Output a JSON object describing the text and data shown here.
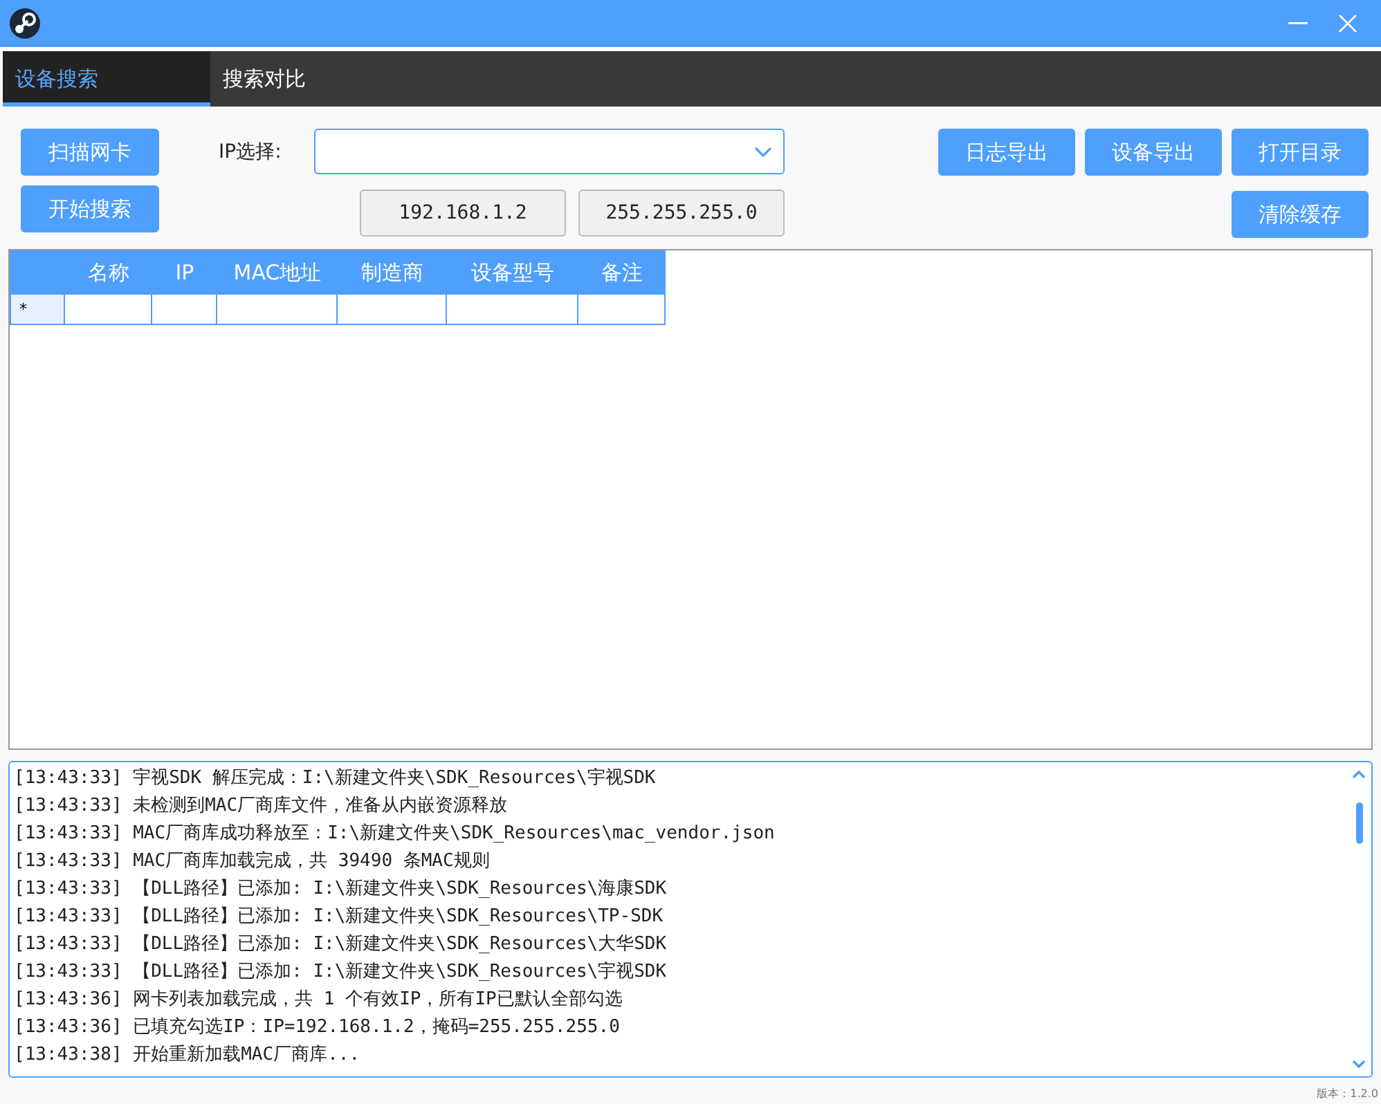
{
  "tabs": [
    {
      "label": "设备搜索",
      "selected": true
    },
    {
      "label": "搜索对比",
      "selected": false
    }
  ],
  "left_buttons": [
    "扫描网卡",
    "开始搜索"
  ],
  "ip_select": {
    "label": "IP选择:"
  },
  "ip_fields": [
    "192.168.1.2",
    "255.255.255.0"
  ],
  "right_buttons": [
    "日志导出",
    "设备导出",
    "打开目录"
  ],
  "clear_button": "清除缓存",
  "table": {
    "columns": [
      "名称",
      "IP",
      "MAC地址",
      "制造商",
      "设备型号",
      "备注"
    ],
    "new_row_marker": "*"
  },
  "log": [
    "[13:43:33] 宇视SDK 解压完成：I:\\新建文件夹\\SDK_Resources\\宇视SDK",
    "[13:43:33] 未检测到MAC厂商库文件，准备从内嵌资源释放",
    "[13:43:33] MAC厂商库成功释放至：I:\\新建文件夹\\SDK_Resources\\mac_vendor.json",
    "[13:43:33] MAC厂商库加载完成，共 39490 条MAC规则",
    "[13:43:33] 【DLL路径】已添加: I:\\新建文件夹\\SDK_Resources\\海康SDK",
    "[13:43:33] 【DLL路径】已添加: I:\\新建文件夹\\SDK_Resources\\TP-SDK",
    "[13:43:33] 【DLL路径】已添加: I:\\新建文件夹\\SDK_Resources\\大华SDK",
    "[13:43:33] 【DLL路径】已添加: I:\\新建文件夹\\SDK_Resources\\宇视SDK",
    "[13:43:36] 网卡列表加载完成，共 1 个有效IP，所有IP已默认全部勾选",
    "[13:43:36] 已填充勾选IP：IP=192.168.1.2，掩码=255.255.255.0",
    "[13:43:38] 开始重新加载MAC厂商库..."
  ],
  "version": "版本：1.2.0"
}
